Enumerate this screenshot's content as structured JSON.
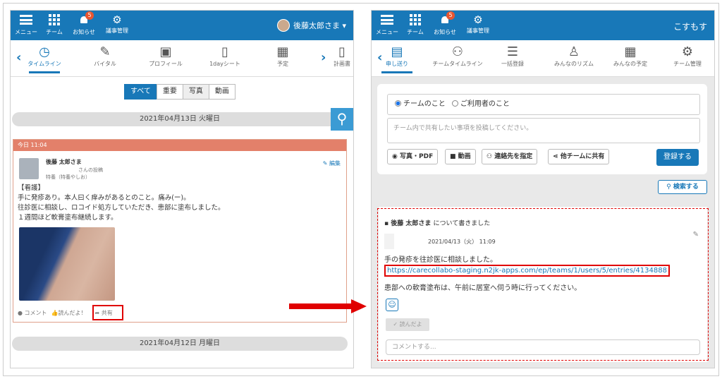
{
  "left": {
    "nav": {
      "menu": "メニュー",
      "team": "チーム",
      "notice": "お知らせ",
      "notice_count": "5",
      "settings": "議事管理",
      "user": "後藤太郎さま ▾"
    },
    "tabs": [
      "タイムライン",
      "バイタル",
      "プロフィール",
      "1dayシート",
      "予定",
      "計画書"
    ],
    "tab_icons": [
      "clock-icon",
      "thermometer-icon",
      "profile-card-icon",
      "clipboard-icon",
      "calendar-icon",
      "clipboard-icon"
    ],
    "filters": [
      "すべて",
      "重要",
      "写真",
      "動画"
    ],
    "date1": "2021年04月13日 火曜日",
    "date2": "2021年04月12日 月曜日",
    "post": {
      "time": "今日 11:04",
      "name": "後藤 太郎さま",
      "posted_by": "さんの投稿",
      "facility": "特養（特養やしお）",
      "edit": "編集",
      "lines": [
        "【看護】",
        "手に発疹あり。本人曰く痒みがあるとのこと。痛み(ー)。",
        "往診医に相談し、ロコイド処方していただき、患部に塗布しました。",
        "１週間ほど軟膏塗布継続します。"
      ],
      "comment": "コメント",
      "read": "読んだよ！",
      "share": "共有"
    }
  },
  "right": {
    "nav": {
      "menu": "メニュー",
      "team": "チーム",
      "notice": "お知らせ",
      "notice_count": "5",
      "settings": "議事管理",
      "title": "こすもす"
    },
    "tabs": [
      "申し送り",
      "チームタイムライン",
      "一括登録",
      "みんなのリズム",
      "みんなの予定",
      "チーム管理"
    ],
    "tab_icons": [
      "clipboard-icon",
      "group-icon",
      "checklist-icon",
      "person-clock-icon",
      "calendar-icon",
      "gears-icon"
    ],
    "radio_team": "チームのこと",
    "radio_user": "ご利用者のこと",
    "placeholder": "チーム内で共有したい事項を投稿してください。",
    "btn_photo": "写真・PDF",
    "btn_video": "動画",
    "btn_contact": "連絡先を指定",
    "btn_share": "他チームに共有",
    "btn_register": "登録する",
    "btn_search": "検索する",
    "entry": {
      "name": "後藤 太郎さま",
      "about": "について書きました",
      "date": "2021/04/13（火） 11:09",
      "line1": "手の発疹を往診医に相談しました。",
      "link": "https://carecollabo-staging.n2jk-apps.com/ep/teams/1/users/5/entries/4134888",
      "line2": "患部への軟膏塗布は、午前に居室へ伺う時に行ってください。",
      "read": "✓ 読んだよ",
      "comment_placeholder": "コメントする..."
    }
  },
  "colors": {
    "brand": "#1878b8",
    "highlight": "#e00000",
    "post_header": "#e3806a"
  }
}
